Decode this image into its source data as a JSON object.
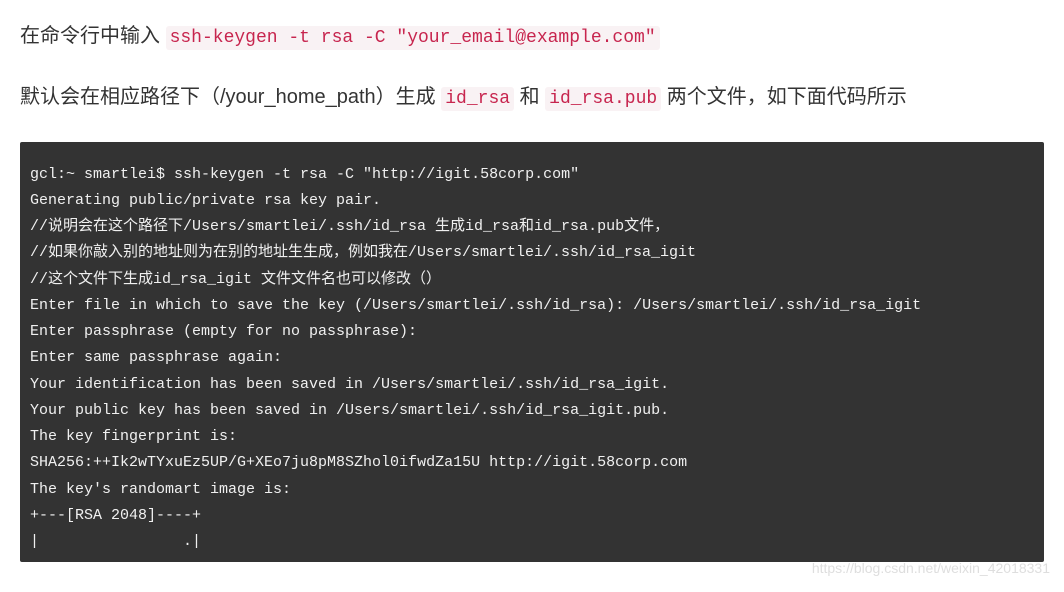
{
  "para1": {
    "prefix": "在命令行中输入",
    "code": "ssh-keygen -t rsa -C \"your_email@example.com\""
  },
  "para2": {
    "part1": "默认会在相应路径下（/your_home_path）生成",
    "code1": "id_rsa",
    "part2": "和",
    "code2": "id_rsa.pub",
    "part3": "两个文件，如下面代码所示"
  },
  "terminal": {
    "lines": "gcl:~ smartlei$ ssh-keygen -t rsa -C \"http://igit.58corp.com\"\nGenerating public/private rsa key pair.\n//说明会在这个路径下/Users/smartlei/.ssh/id_rsa 生成id_rsa和id_rsa.pub文件，\n//如果你敲入别的地址则为在别的地址生生成，例如我在/Users/smartlei/.ssh/id_rsa_igit\n//这个文件下生成id_rsa_igit 文件文件名也可以修改（）\nEnter file in which to save the key (/Users/smartlei/.ssh/id_rsa): /Users/smartlei/.ssh/id_rsa_igit\nEnter passphrase (empty for no passphrase):\nEnter same passphrase again:\nYour identification has been saved in /Users/smartlei/.ssh/id_rsa_igit.\nYour public key has been saved in /Users/smartlei/.ssh/id_rsa_igit.pub.\nThe key fingerprint is:\nSHA256:++Ik2wTYxuEz5UP/G+XEo7ju8pM8SZhol0ifwdZa15U http://igit.58corp.com\nThe key's randomart image is:\n+---[RSA 2048]----+\n|                .|"
  },
  "watermark": "https://blog.csdn.net/weixin_42018331"
}
